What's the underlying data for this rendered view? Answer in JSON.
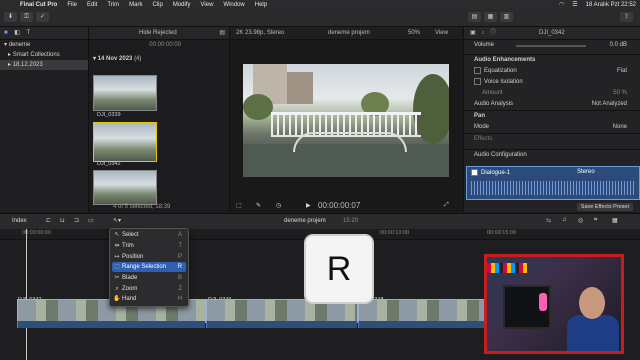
{
  "menubar": {
    "app": "Final Cut Pro",
    "items": [
      "File",
      "Edit",
      "Trim",
      "Mark",
      "Clip",
      "Modify",
      "View",
      "Window",
      "Help"
    ],
    "clock": "18 Aralık Pzt  22:52"
  },
  "library": {
    "name": "deneme",
    "smart_collections": "Smart Collections",
    "event": "18.12.2023"
  },
  "browser": {
    "filter": "Hide Rejected",
    "timecode": "00:00:00:00",
    "date_group": "14 Nov 2023",
    "group_count": "(4)",
    "clip1": "DJI_0339",
    "clip2": "DJI_0342",
    "status": "4 of 5 selected, 18:39"
  },
  "viewer": {
    "format": "2K 23.98p, Stereo",
    "project": "deneme projem",
    "zoom": "50%",
    "view": "View",
    "timecode": "00:00:00:07"
  },
  "inspector": {
    "clip_name": "DJI_0342",
    "volume_label": "Volume",
    "volume_value": "0.0",
    "volume_unit": "dB",
    "audio_enh": "Audio Enhancements",
    "equalization": "Equalization",
    "eq_value": "Flat",
    "voice_iso": "Voice Isolation",
    "amount": "Amount",
    "amount_value": "50",
    "amount_unit": "%",
    "audio_analysis": "Audio Analysis",
    "analysis_value": "Not Analyzed",
    "pan": "Pan",
    "mode": "Mode",
    "mode_value": "None",
    "effects": "Effects",
    "audio_config": "Audio Configuration",
    "dialogue": "Dialogue-1",
    "stereo": "Stereo",
    "save_preset": "Save Effects Preset"
  },
  "timeline": {
    "index": "Index",
    "project": "deneme projem",
    "duration": "15:20",
    "ruler_start": "00:00:00:00",
    "ruler_mid": "00:00:10:00",
    "ruler_end": "00:00:15:00",
    "clips": [
      "DJI_0342",
      "DJI_0346",
      "DJI_0348"
    ]
  },
  "toolmenu": {
    "items": [
      {
        "label": "Select",
        "key": "A"
      },
      {
        "label": "Trim",
        "key": "T"
      },
      {
        "label": "Position",
        "key": "P"
      },
      {
        "label": "Range Selection",
        "key": "R"
      },
      {
        "label": "Blade",
        "key": "B"
      },
      {
        "label": "Zoom",
        "key": "Z"
      },
      {
        "label": "Hand",
        "key": "H"
      }
    ]
  },
  "key_overlay": "R"
}
